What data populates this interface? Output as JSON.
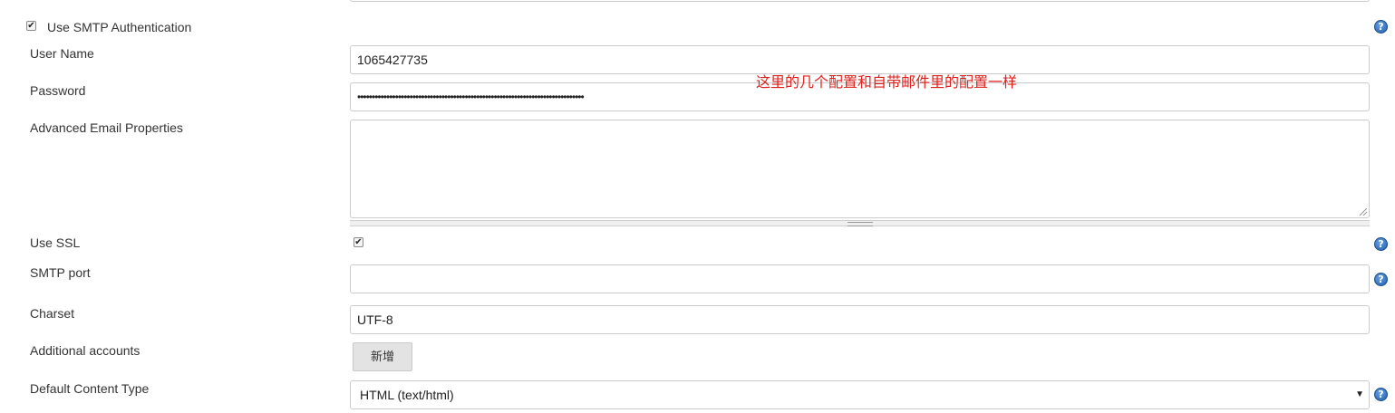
{
  "smtp_auth": {
    "label": "Use SMTP Authentication",
    "checked": true
  },
  "user_name": {
    "label": "User Name",
    "value": "1065427735"
  },
  "password": {
    "label": "Password",
    "masked_value": "••••••••••••••••••••••••••••••••••••••••••••••••••••••••••••••••••••••••••••••"
  },
  "advanced_props": {
    "label": "Advanced Email Properties",
    "value": ""
  },
  "use_ssl": {
    "label": "Use SSL",
    "checked": true
  },
  "smtp_port": {
    "label": "SMTP port",
    "value": ""
  },
  "charset": {
    "label": "Charset",
    "value": "UTF-8"
  },
  "additional_accounts": {
    "label": "Additional accounts",
    "add_button": "新增"
  },
  "content_type": {
    "label": "Default Content Type",
    "selected": "HTML (text/html)"
  },
  "annotation": "这里的几个配置和自带邮件里的配置一样",
  "help_icon_glyph": "?",
  "colors": {
    "annotation": "#e0201b",
    "help_icon": "#1f5fae",
    "border": "#cccccc"
  }
}
